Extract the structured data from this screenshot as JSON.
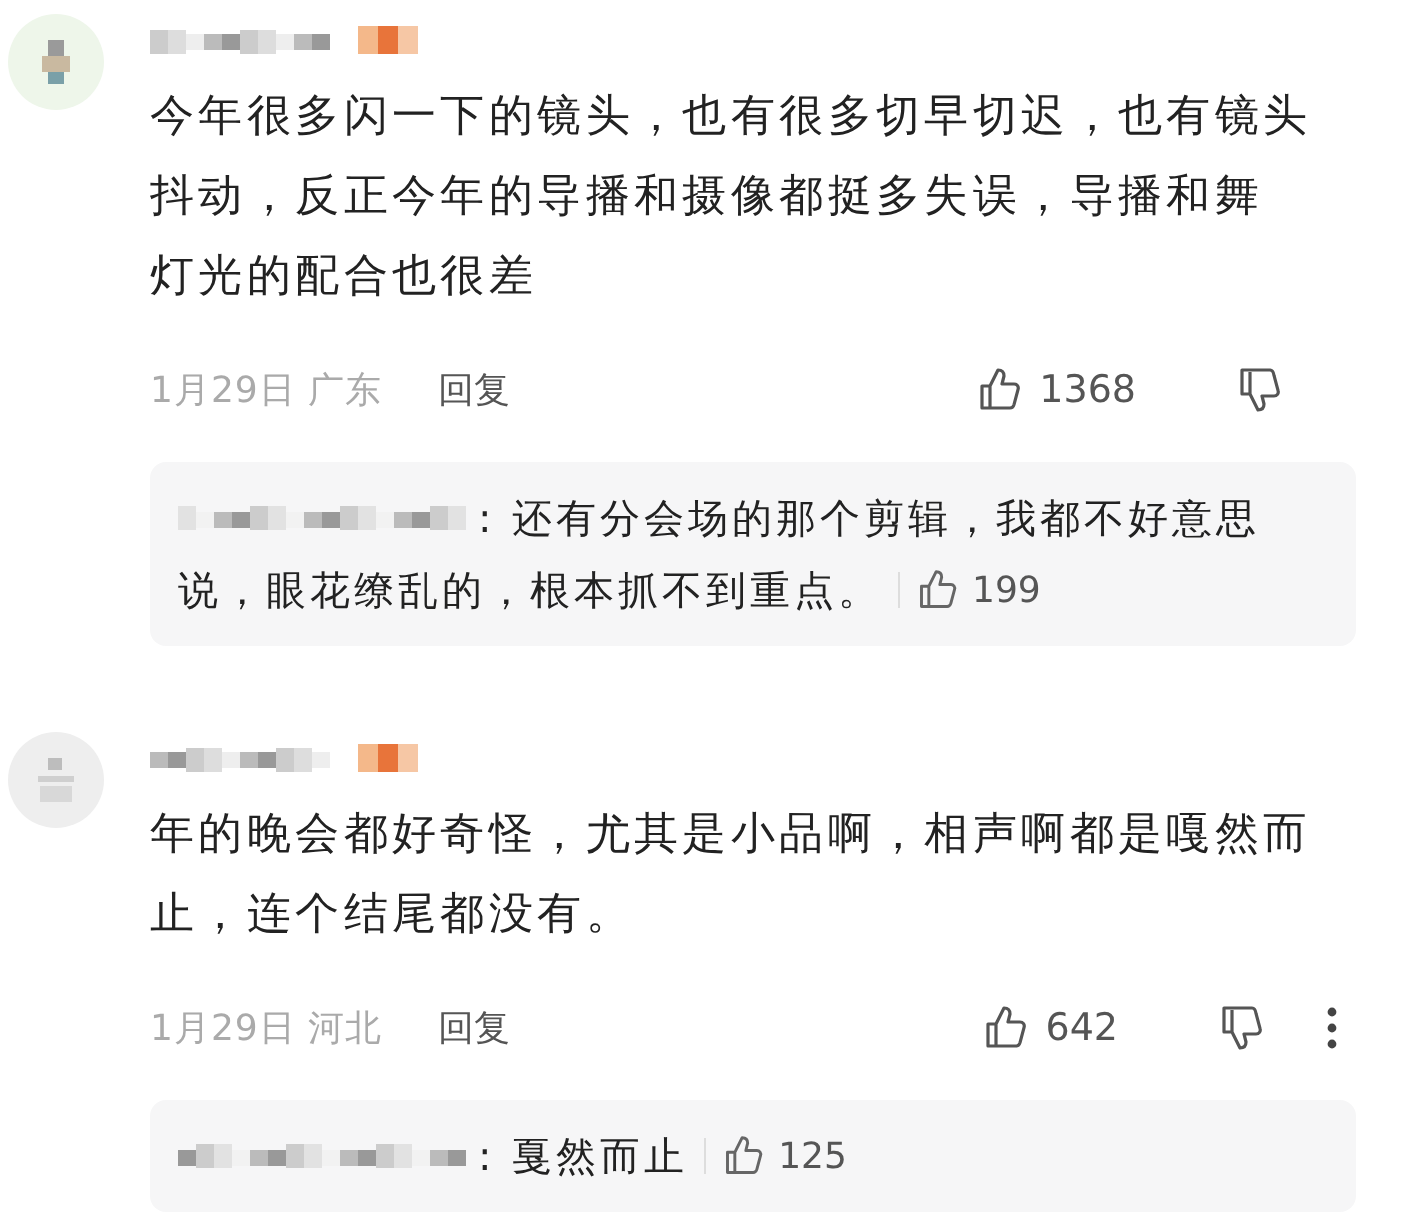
{
  "comments": [
    {
      "avatar": {
        "color": "#eef6ea"
      },
      "text_lines": [
        "今年很多闪一下的镜头，也有很多切早切迟，也有镜头",
        "抖动，反正今年的导播和摄像都挺多失误，导播和舞",
        "灯光的配合也很差"
      ],
      "date_location": "1月29日 广东",
      "reply_label": "回复",
      "likes": "1368",
      "more_menu": false,
      "reply": {
        "text_lines": [
          ": 还有分会场的那个剪辑，我都不好意思",
          "说，眼花缭乱的，根本抓不到重点。"
        ],
        "likes": "199"
      }
    },
    {
      "avatar": {
        "color": "#eeeeee"
      },
      "text_lines": [
        "年的晚会都好奇怪，尤其是小品啊，相声啊都是嘎然而",
        "止，连个结尾都没有。"
      ],
      "date_location": "1月29日 河北",
      "reply_label": "回复",
      "likes": "642",
      "more_menu": true,
      "reply": {
        "text_lines": [
          ": 戛然而止"
        ],
        "likes": "125"
      }
    }
  ]
}
